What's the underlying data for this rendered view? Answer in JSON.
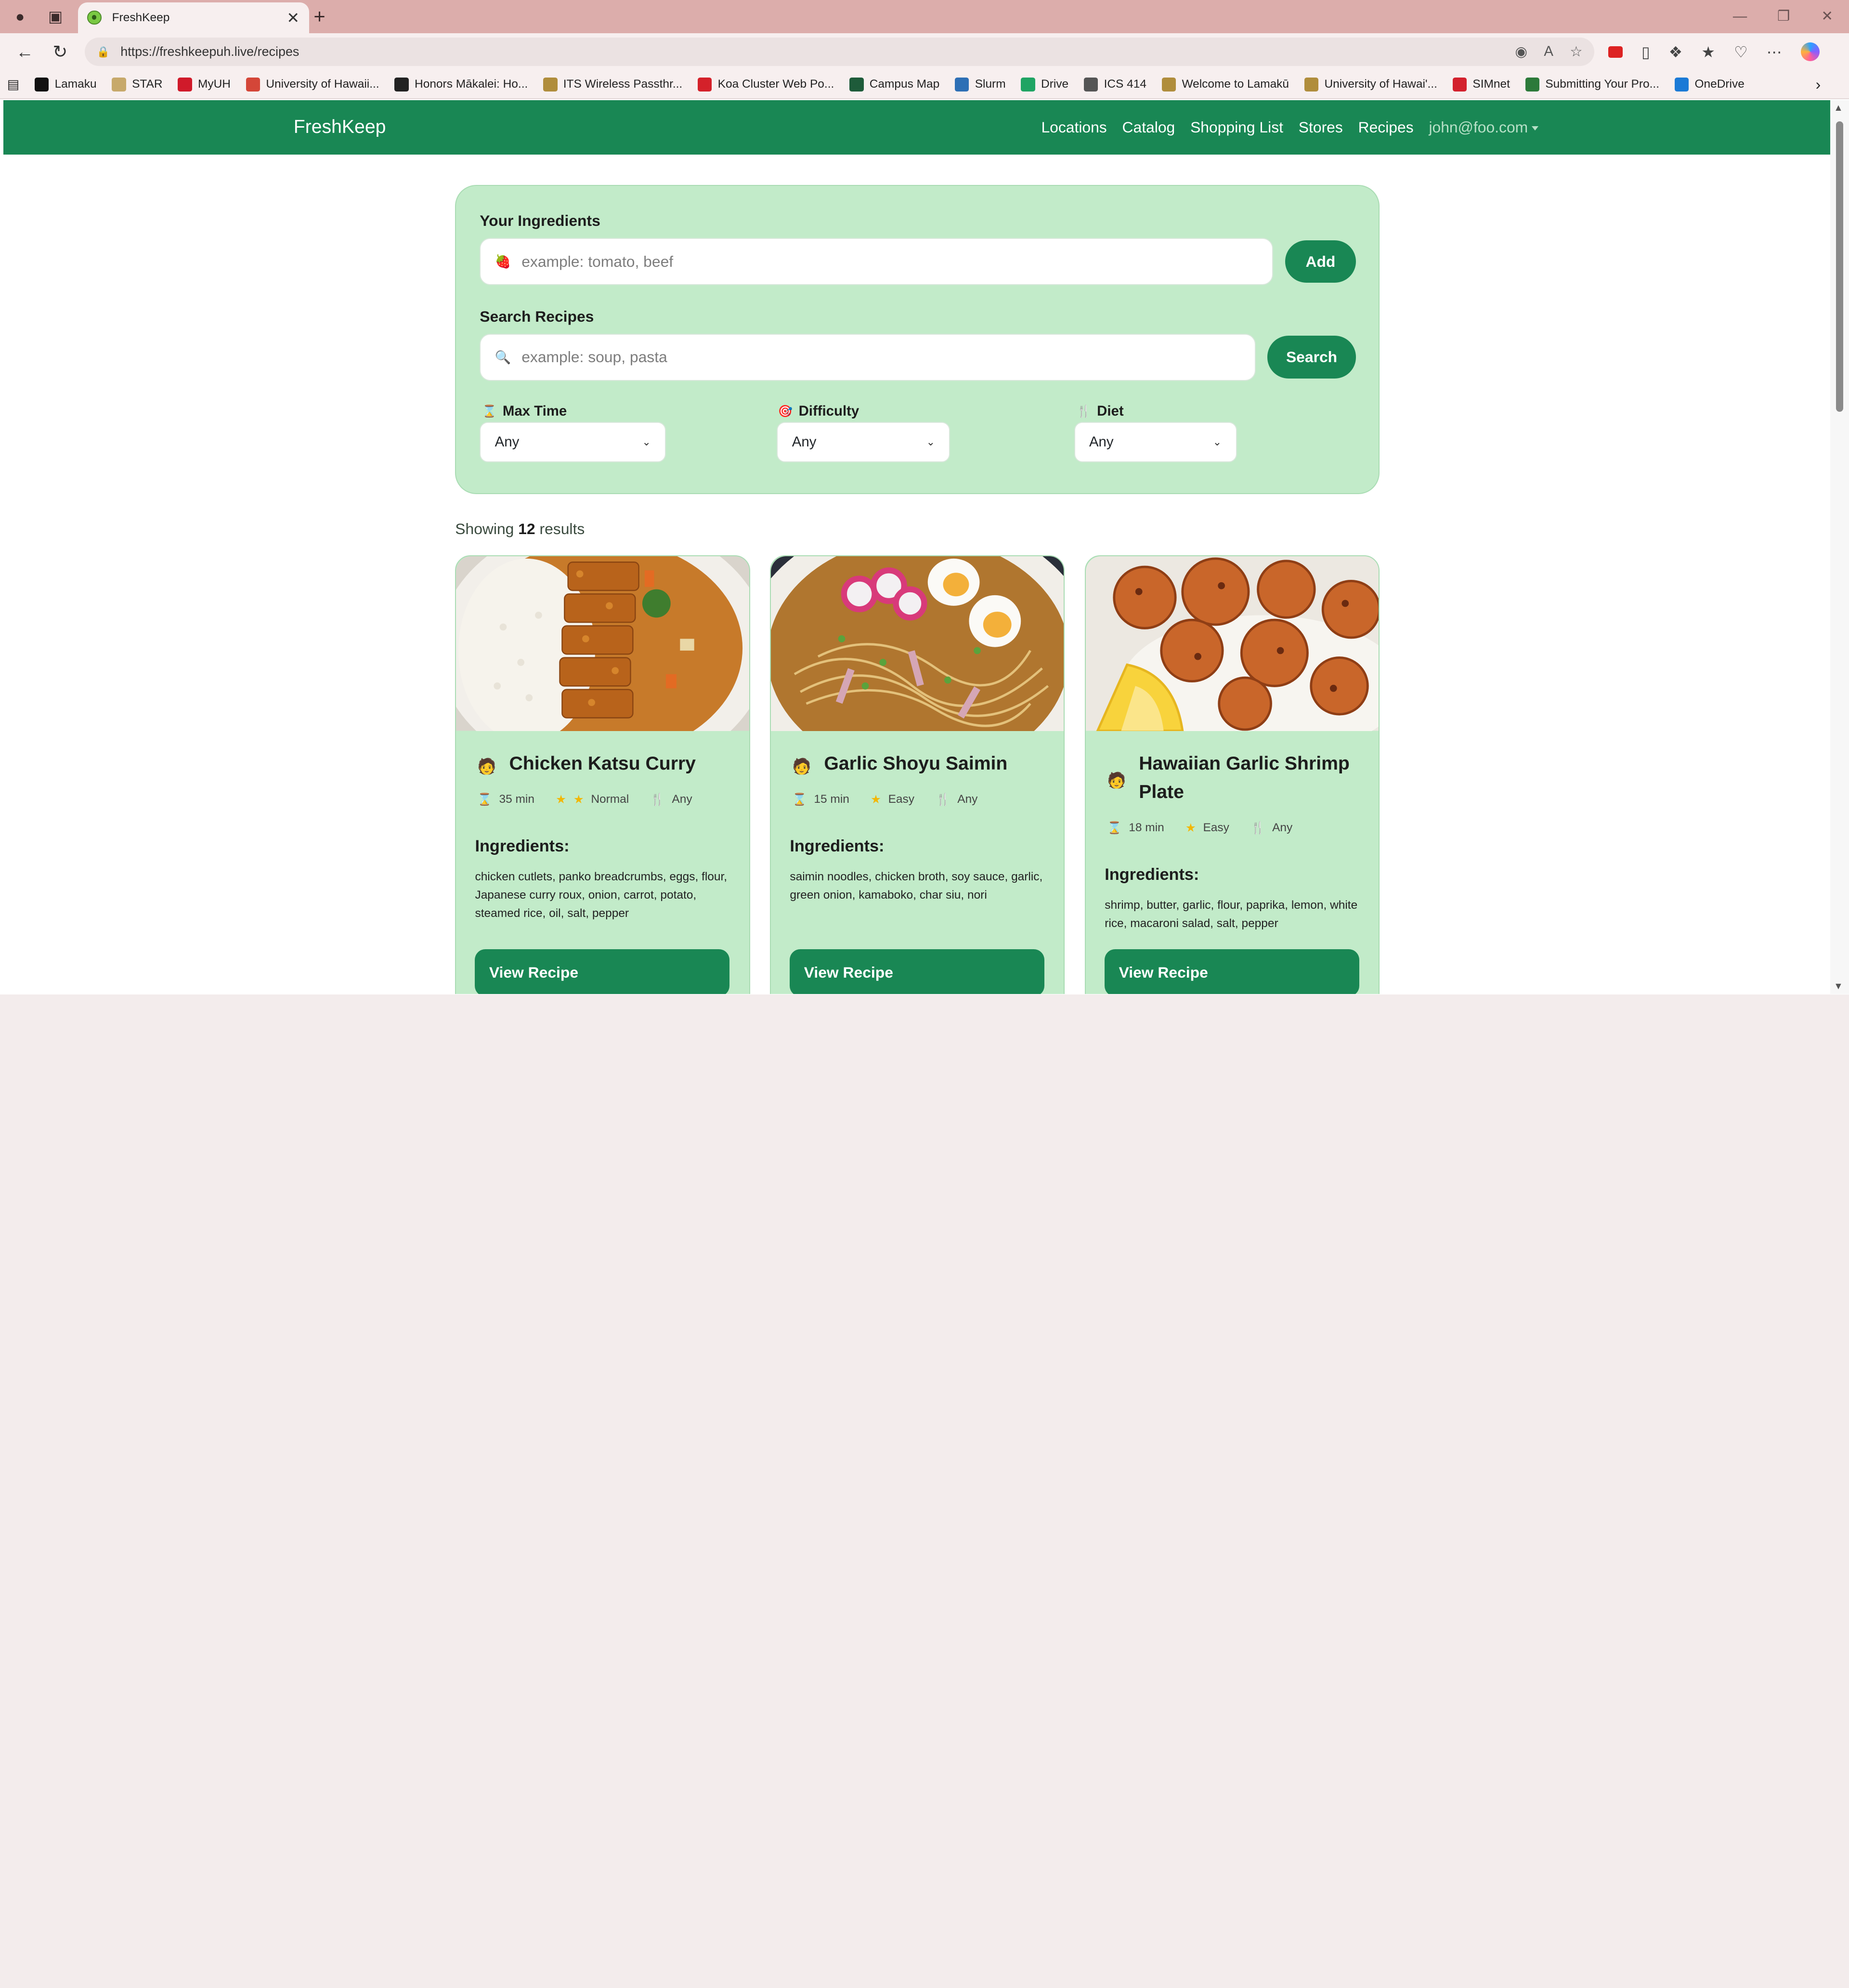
{
  "browser": {
    "tab_title": "FreshKeep",
    "url": "https://freshkeepuh.live/recipes",
    "bookmarks": [
      {
        "label": "Lamaku",
        "color": "#111111"
      },
      {
        "label": "STAR",
        "color": "#c7a96b"
      },
      {
        "label": "MyUH",
        "color": "#d01a2a"
      },
      {
        "label": "University of Hawaii...",
        "color": "#d44638"
      },
      {
        "label": "Honors Mākalei: Ho...",
        "color": "#222222"
      },
      {
        "label": "ITS Wireless Passthr...",
        "color": "#b08d3c"
      },
      {
        "label": "Koa Cluster Web Po...",
        "color": "#d4212a"
      },
      {
        "label": "Campus Map",
        "color": "#1e5b3a"
      },
      {
        "label": "Slurm",
        "color": "#2d6fb5"
      },
      {
        "label": "Drive",
        "color": "#1fa463"
      },
      {
        "label": "ICS 414",
        "color": "#555555"
      },
      {
        "label": "Welcome to Lamakū",
        "color": "#b08d3c"
      },
      {
        "label": "University of Hawai'...",
        "color": "#b08d3c"
      },
      {
        "label": "SIMnet",
        "color": "#d3212d"
      },
      {
        "label": "Submitting Your Pro...",
        "color": "#2c7a3a"
      },
      {
        "label": "OneDrive",
        "color": "#1b7ad6"
      }
    ]
  },
  "navbar": {
    "brand": "FreshKeep",
    "links": [
      "Locations",
      "Catalog",
      "Shopping List",
      "Stores",
      "Recipes"
    ],
    "user": "john@foo.com"
  },
  "filters": {
    "ingredients_label": "Your Ingredients",
    "ingredients_placeholder": "example: tomato, beef",
    "add_label": "Add",
    "search_label": "Search Recipes",
    "search_placeholder": "example: soup, pasta",
    "search_button": "Search",
    "max_time_label": "Max Time",
    "max_time_value": "Any",
    "difficulty_label": "Difficulty",
    "difficulty_value": "Any",
    "diet_label": "Diet",
    "diet_value": "Any"
  },
  "results": {
    "prefix": "Showing",
    "count": "12",
    "suffix": "results"
  },
  "recipes": [
    {
      "title": "Chicken Katsu Curry",
      "time": "35 min",
      "difficulty": "Normal",
      "stars": 2,
      "diet": "Any",
      "ingredients_heading": "Ingredients:",
      "ingredients": "chicken cutlets, panko breadcrumbs, eggs, flour, Japanese curry roux, onion, carrot, potato, steamed rice, oil, salt, pepper",
      "button": "View Recipe"
    },
    {
      "title": "Garlic Shoyu Saimin",
      "time": "15 min",
      "difficulty": "Easy",
      "stars": 1,
      "diet": "Any",
      "ingredients_heading": "Ingredients:",
      "ingredients": "saimin noodles, chicken broth, soy sauce, garlic, green onion, kamaboko, char siu, nori",
      "button": "View Recipe"
    },
    {
      "title": "Hawaiian Garlic Shrimp Plate",
      "time": "18 min",
      "difficulty": "Easy",
      "stars": 1,
      "diet": "Any",
      "ingredients_heading": "Ingredients:",
      "ingredients": "shrimp, butter, garlic, flour, paprika, lemon, white rice, macaroni salad, salt, pepper",
      "button": "View Recipe"
    }
  ]
}
